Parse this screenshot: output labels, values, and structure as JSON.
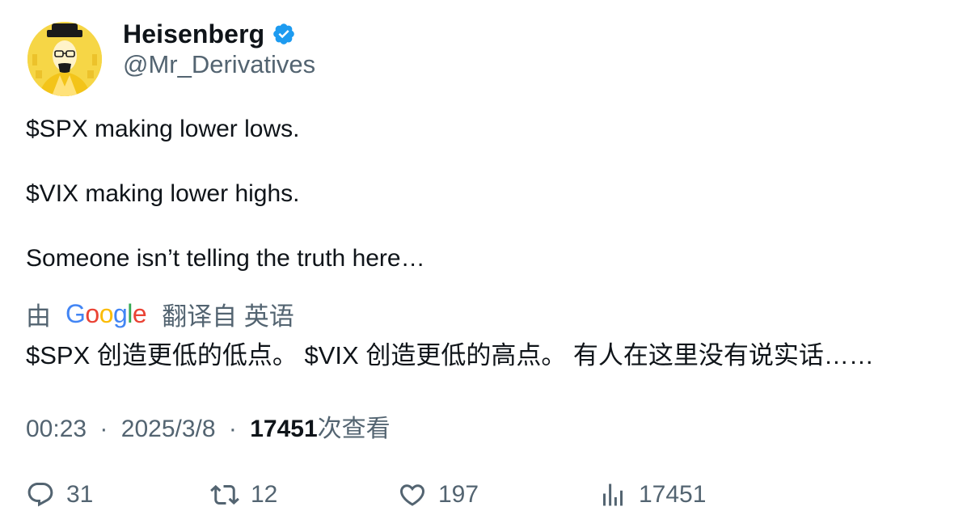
{
  "author": {
    "display_name": "Heisenberg",
    "handle": "@Mr_Derivatives",
    "verified_icon": "verified-badge-icon",
    "verified_color": "#1d9bf0"
  },
  "tweet": {
    "lines": [
      "$SPX making lower lows.",
      "$VIX making lower highs.",
      "Someone isn’t telling the truth here…"
    ]
  },
  "translation": {
    "prefix": "由",
    "provider": "Google",
    "suffix": "翻译自 英语",
    "text": "$SPX 创造更低的低点。 $VIX 创造更低的高点。 有人在这里没有说实话……"
  },
  "meta": {
    "time": "00:23",
    "separator": "·",
    "date": "2025/3/8",
    "views_count": "17451",
    "views_label": "次查看"
  },
  "actions": {
    "reply": {
      "icon": "reply-icon",
      "count": "31"
    },
    "retweet": {
      "icon": "retweet-icon",
      "count": "12"
    },
    "like": {
      "icon": "heart-icon",
      "count": "197"
    },
    "views": {
      "icon": "views-chart-icon",
      "count": "17451"
    }
  },
  "colors": {
    "text_primary": "#0f1419",
    "text_secondary": "#536471",
    "google_blue": "#4285f4",
    "google_red": "#ea4335",
    "google_yellow": "#fbbc05",
    "google_green": "#34a853"
  }
}
